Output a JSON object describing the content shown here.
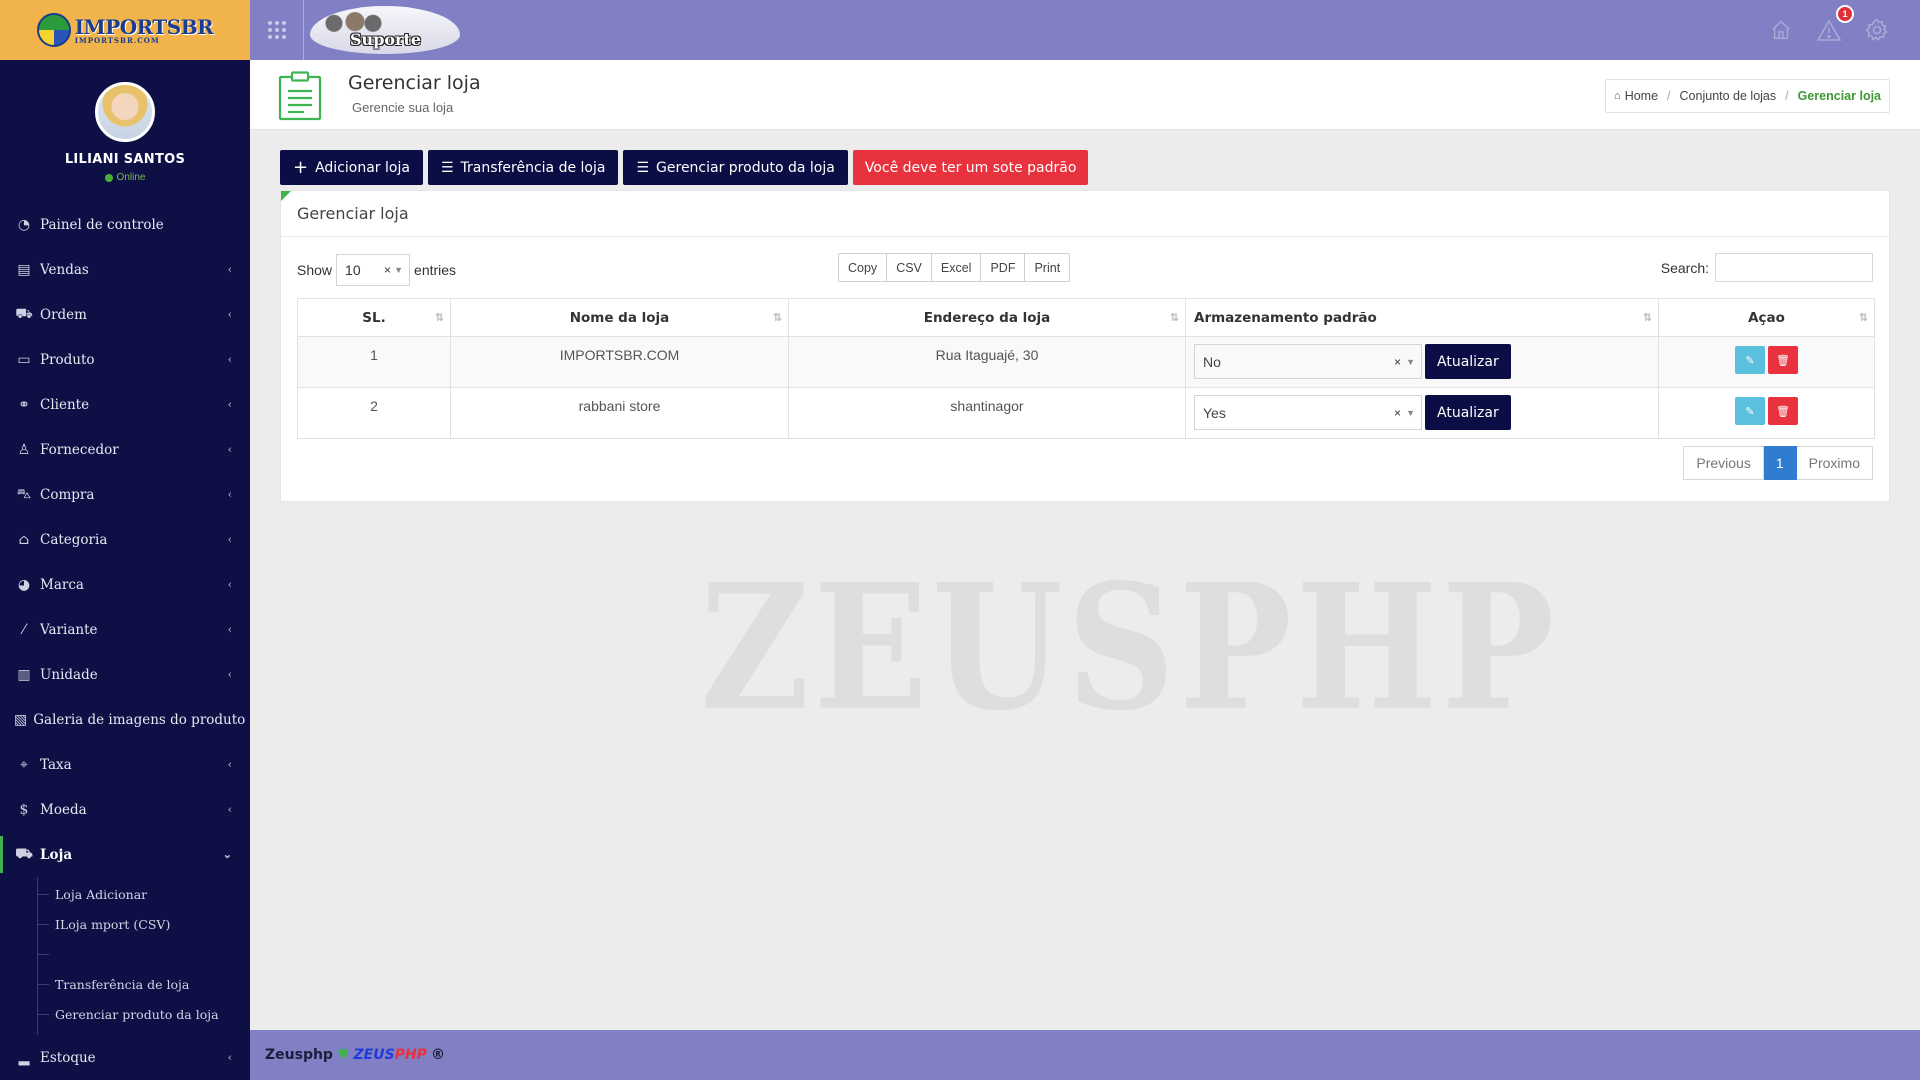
{
  "logo": {
    "text": "IMPORTSBR",
    "subtext": "IMPORTSBR.COM"
  },
  "topbar": {
    "support_label": "Suporte",
    "notification_count": "1"
  },
  "user": {
    "name": "LILIANI SANTOS",
    "status": "Online"
  },
  "sidebar": {
    "items": [
      {
        "label": "Painel de controle",
        "icon": "dashboard-icon"
      },
      {
        "label": "Vendas",
        "icon": "sales-icon"
      },
      {
        "label": "Ordem",
        "icon": "order-icon"
      },
      {
        "label": "Produto",
        "icon": "product-icon"
      },
      {
        "label": "Cliente",
        "icon": "handshake-icon"
      },
      {
        "label": "Fornecedor",
        "icon": "user-icon"
      },
      {
        "label": "Compra",
        "icon": "cart-icon"
      },
      {
        "label": "Categoria",
        "icon": "tag-icon"
      },
      {
        "label": "Marca",
        "icon": "brand-icon"
      },
      {
        "label": "Variante",
        "icon": "magic-icon"
      },
      {
        "label": "Unidade",
        "icon": "ruler-icon"
      },
      {
        "label": "Galeria de imagens do produto",
        "icon": "gallery-icon"
      },
      {
        "label": "Taxa",
        "icon": "crosshair-icon"
      },
      {
        "label": "Moeda",
        "icon": "dollar-icon"
      },
      {
        "label": "Loja",
        "icon": "store-icon"
      },
      {
        "label": "Estoque",
        "icon": "stock-icon"
      }
    ],
    "loja_submenu": [
      "Loja Adicionar",
      "ILoja mport (CSV)",
      "",
      "Transferência de loja",
      "Gerenciar produto da loja"
    ]
  },
  "page": {
    "title": "Gerenciar loja",
    "subtitle": "Gerencie sua loja",
    "breadcrumb": [
      "Home",
      "Conjunto de lojas",
      "Gerenciar loja"
    ]
  },
  "actions": {
    "add": "Adicionar loja",
    "transfer": "Transferência de loja",
    "manage_products": "Gerenciar produto da loja",
    "warning": "Você deve ter um sote padrão"
  },
  "panel": {
    "title": "Gerenciar loja",
    "show_label": "Show",
    "show_value": "10",
    "entries_label": "entries",
    "export_buttons": [
      "Copy",
      "CSV",
      "Excel",
      "PDF",
      "Print"
    ],
    "search_label": "Search:"
  },
  "table": {
    "headers": [
      "SL.",
      "Nome da loja",
      "Endereço da loja",
      "Armazenamento padrão",
      "Açao"
    ],
    "rows": [
      {
        "sl": "1",
        "name": "IMPORTSBR.COM",
        "address": "Rua Itaguajé, 30",
        "default": "No",
        "update": "Atualizar"
      },
      {
        "sl": "2",
        "name": "rabbani store",
        "address": "shantinagor",
        "default": "Yes",
        "update": "Atualizar"
      }
    ]
  },
  "pagination": {
    "previous": "Previous",
    "page": "1",
    "next": "Proximo"
  },
  "watermark": "ZEUSPHP",
  "footer": {
    "name": "Zeusphp",
    "brand_a": "ZEUS",
    "brand_b": "PHP",
    "mark": "®"
  },
  "colors": {
    "sidebar": "#0d0f45",
    "topbar": "#8180c4",
    "accent_green": "#3fb34f",
    "danger": "#e8323e",
    "primary_dark": "#0b0e45"
  }
}
